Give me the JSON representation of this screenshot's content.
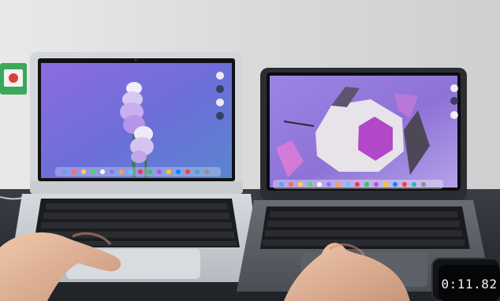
{
  "stopwatch": {
    "time": "0:11.82"
  },
  "colors": {
    "wall": "#dcdcdc",
    "desk": "#2a2d33",
    "silver_body": "#c9ccd0",
    "space_gray_body": "#55585e",
    "purple_wallpaper": "#8a63d8",
    "mojave_purple": "#7a4fd6",
    "skin": "#e0b49a"
  },
  "icons": {
    "left_laptop_dock": "dock-icon",
    "right_laptop_dock": "dock-icon",
    "sticker": "sticker-icon"
  }
}
